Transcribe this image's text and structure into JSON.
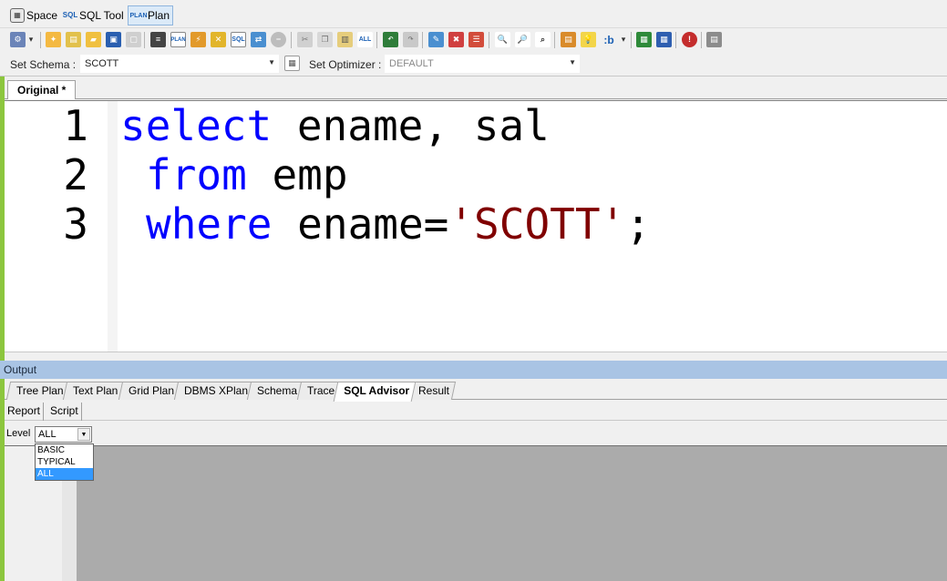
{
  "mode_tabs": [
    {
      "label": "Space",
      "icon": "space-icon"
    },
    {
      "label": "SQL Tool",
      "icon": "sql-icon"
    },
    {
      "label": "Plan",
      "icon": "plan-icon",
      "active": true
    }
  ],
  "toolbar": {
    "icons": [
      "gear-icon",
      "new-icon",
      "open-folder-icon",
      "save-icon",
      "disabled-icon",
      "format-icon",
      "explain-plan-icon",
      "run-icon",
      "tune-icon",
      "sql-run-icon",
      "compare-icon",
      "stop-icon",
      "cut-icon",
      "copy-icon",
      "paste-icon",
      "select-all-icon",
      "undo-icon",
      "redo-icon",
      "comment-icon",
      "uncomment-icon",
      "indent-icon",
      "find-icon",
      "find-next-icon",
      "replace-icon",
      "history-icon",
      "hint-icon",
      "bind-icon",
      "grid-icon",
      "table-icon",
      "alert-icon",
      "options-icon"
    ],
    "bind_label": ":b"
  },
  "schema": {
    "schema_label": "Set Schema :",
    "schema_value": "SCOTT",
    "optimizer_label": "Set Optimizer :",
    "optimizer_value": "DEFAULT"
  },
  "editor": {
    "tab_label": "Original *",
    "line_numbers": [
      "1",
      "2",
      "3"
    ],
    "lines": [
      {
        "kw": "select",
        "rest": " ename, sal"
      },
      {
        "kw": "from",
        "rest": " emp"
      },
      {
        "kw": "where",
        "rest": " ename=",
        "str": "'SCOTT'",
        "end": ";"
      }
    ]
  },
  "output": {
    "title": "Output",
    "tabs": [
      "Tree Plan",
      "Text Plan",
      "Grid Plan",
      "DBMS XPlan",
      "Schema",
      "Trace",
      "SQL Advisor",
      "Result"
    ],
    "active_tab": "SQL Advisor",
    "sub_tabs": [
      "Report",
      "Script"
    ],
    "level_label": "Level",
    "level_value": "ALL",
    "level_options": [
      "BASIC",
      "TYPICAL",
      "ALL"
    ],
    "level_selected": "ALL"
  },
  "colors": {
    "keyword": "#0000ff",
    "string": "#800000",
    "accent_stripe": "#8cc63e",
    "output_header": "#a9c4e4"
  }
}
